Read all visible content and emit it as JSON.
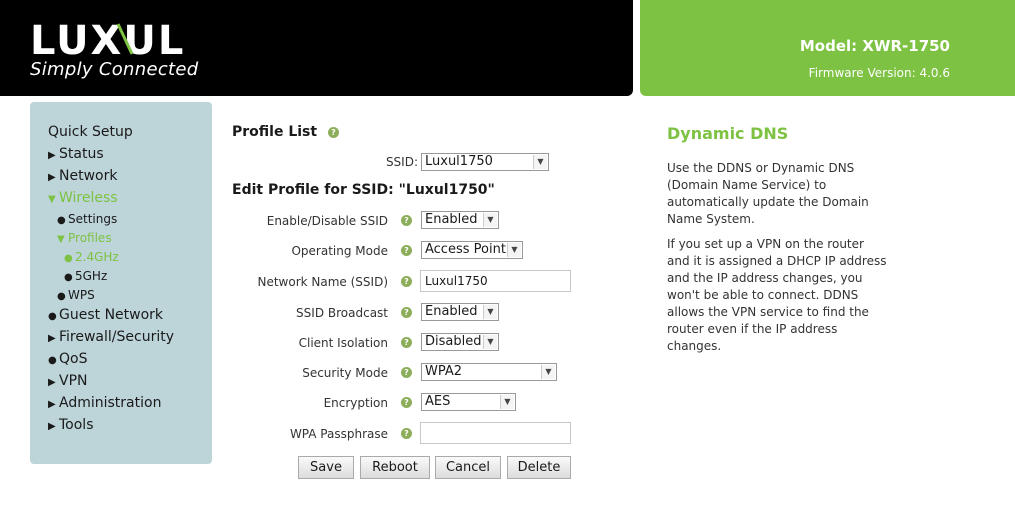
{
  "header": {
    "logo_text": "LUXUL",
    "tagline": "Simply Connected",
    "model": "Model: XWR-1750",
    "firmware": "Firmware Version: 4.0.6",
    "colors": {
      "header_black": "#000000",
      "brand_green": "#7dc242",
      "sidebar": "#bdd4d9"
    }
  },
  "sidebar": {
    "quick_setup": "Quick Setup",
    "status": "Status",
    "network": "Network",
    "wireless": "Wireless",
    "settings": "Settings",
    "profiles": "Profiles",
    "band_24": "2.4GHz",
    "band_5": "5GHz",
    "wps": "WPS",
    "guest_network": "Guest Network",
    "firewall": "Firewall/Security",
    "qos": "QoS",
    "vpn": "VPN",
    "administration": "Administration",
    "tools": "Tools"
  },
  "form": {
    "profile_list_title": "Profile List",
    "ssid_label": "SSID:",
    "ssid_value": "Luxul1750",
    "edit_title": "Edit Profile for SSID: \"Luxul1750\"",
    "rows": {
      "enable": {
        "label": "Enable/Disable SSID",
        "value": "Enabled"
      },
      "mode": {
        "label": "Operating Mode",
        "value": "Access Point"
      },
      "name": {
        "label": "Network Name (SSID)",
        "value": "Luxul1750"
      },
      "broadcast": {
        "label": "SSID Broadcast",
        "value": "Enabled"
      },
      "isolation": {
        "label": "Client Isolation",
        "value": "Disabled"
      },
      "security": {
        "label": "Security Mode",
        "value": "WPA2"
      },
      "encryption": {
        "label": "Encryption",
        "value": "AES"
      },
      "passphrase": {
        "label": "WPA Passphrase",
        "value": ""
      }
    },
    "buttons": {
      "save": "Save",
      "reboot": "Reboot",
      "cancel": "Cancel",
      "delete": "Delete"
    }
  },
  "info": {
    "title": "Dynamic DNS",
    "p1": "Use the DDNS or Dynamic DNS (Domain Name Service) to automatically update the Domain Name System.",
    "p2": "If you set up a VPN on the router and it is assigned a DHCP IP address and the IP address changes, you won't be able to connect. DDNS allows the VPN service to find the router even if the IP address changes."
  }
}
